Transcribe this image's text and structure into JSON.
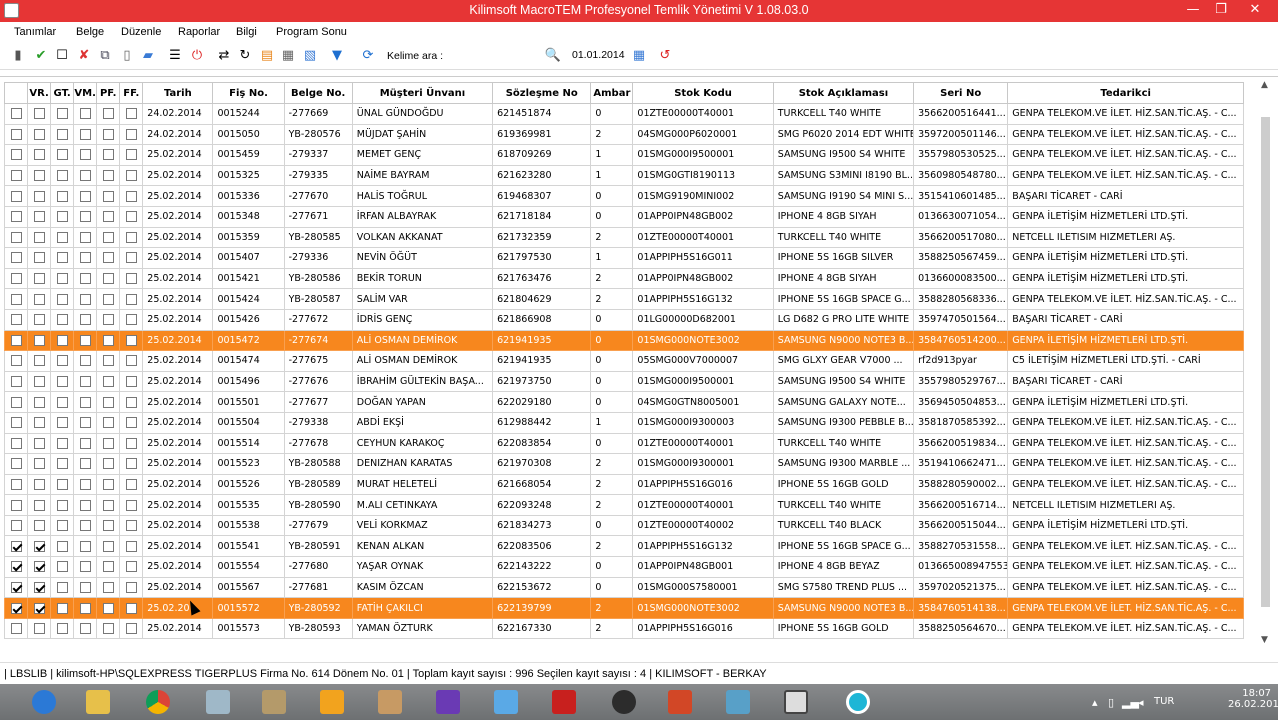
{
  "window": {
    "title": "Kilimsoft MacroTEM Profesyonel Temlik Yönetimi V 1.08.03.0"
  },
  "menu": [
    "Tanımlar",
    "Belge",
    "Düzenle",
    "Raporlar",
    "Bilgi",
    "Program Sonu"
  ],
  "toolbar": {
    "search_label": "Kelime ara :",
    "search_value": "",
    "date": "01.01.2014"
  },
  "grid": {
    "columns": [
      "",
      "VR.",
      "GT.",
      "VM.",
      "PF.",
      "FF.",
      "Tarih",
      "Fiş No.",
      "Belge No.",
      "Müşteri Ünvanı",
      "Sözleşme No",
      "Ambar",
      "Stok Kodu",
      "Stok Açıklaması",
      "Seri No",
      "Tedarikci"
    ],
    "rows": [
      {
        "checks": [
          false,
          false,
          false,
          false,
          false,
          false
        ],
        "cells": [
          "24.02.2014",
          "0015244",
          "-277669",
          "ÜNAL GÜNDOĞDU",
          "621451874",
          "0",
          "01ZTE00000T40001",
          "TURKCELL T40 WHITE",
          "3566200516441...",
          "GENPA TELEKOM.VE İLET. HİZ.SAN.TİC.AŞ. - C..."
        ],
        "selected": false
      },
      {
        "checks": [
          false,
          false,
          false,
          false,
          false,
          false
        ],
        "cells": [
          "24.02.2014",
          "0015050",
          "YB-280576",
          "MÜJDAT ŞAHİN",
          "619369981",
          "2",
          "04SMG000P6020001",
          "SMG P6020 2014 EDT WHITE",
          "3597200501146...",
          "GENPA TELEKOM.VE İLET. HİZ.SAN.TİC.AŞ. - C..."
        ],
        "selected": false
      },
      {
        "checks": [
          false,
          false,
          false,
          false,
          false,
          false
        ],
        "cells": [
          "25.02.2014",
          "0015459",
          "-279337",
          "MEMET GENÇ",
          "618709269",
          "1",
          "01SMG000I9500001",
          "SAMSUNG I9500 S4 WHITE",
          "3557980530525...",
          "GENPA TELEKOM.VE İLET. HİZ.SAN.TİC.AŞ. - C..."
        ],
        "selected": false
      },
      {
        "checks": [
          false,
          false,
          false,
          false,
          false,
          false
        ],
        "cells": [
          "25.02.2014",
          "0015325",
          "-279335",
          "NAİME BAYRAM",
          "621623280",
          "1",
          "01SMG0GTI8190113",
          "SAMSUNG S3MINI I8190 BL...",
          "3560980548780...",
          "GENPA TELEKOM.VE İLET. HİZ.SAN.TİC.AŞ. - C..."
        ],
        "selected": false
      },
      {
        "checks": [
          false,
          false,
          false,
          false,
          false,
          false
        ],
        "cells": [
          "25.02.2014",
          "0015336",
          "-277670",
          "HALİS TOĞRUL",
          "619468307",
          "0",
          "01SMG9190MINI002",
          "SAMSUNG I9190 S4 MINI S...",
          "3515410601485...",
          "BAŞARI TİCARET - CARİ"
        ],
        "selected": false
      },
      {
        "checks": [
          false,
          false,
          false,
          false,
          false,
          false
        ],
        "cells": [
          "25.02.2014",
          "0015348",
          "-277671",
          "İRFAN ALBAYRAK",
          "621718184",
          "0",
          "01APP0IPN48GB002",
          "IPHONE 4 8GB SIYAH",
          "0136630071054...",
          "GENPA İLETİŞİM HİZMETLERİ LTD.ŞTİ."
        ],
        "selected": false
      },
      {
        "checks": [
          false,
          false,
          false,
          false,
          false,
          false
        ],
        "cells": [
          "25.02.2014",
          "0015359",
          "YB-280585",
          "VOLKAN AKKANAT",
          "621732359",
          "2",
          "01ZTE00000T40001",
          "TURKCELL T40 WHITE",
          "3566200517080...",
          "NETCELL ILETISIM HIZMETLERI AŞ."
        ],
        "selected": false
      },
      {
        "checks": [
          false,
          false,
          false,
          false,
          false,
          false
        ],
        "cells": [
          "25.02.2014",
          "0015407",
          "-279336",
          "NEVİN ÖĞÜT",
          "621797530",
          "1",
          "01APPIPH5S16G011",
          "IPHONE 5S 16GB SILVER",
          "3588250567459...",
          "GENPA İLETİŞİM HİZMETLERİ LTD.ŞTİ."
        ],
        "selected": false
      },
      {
        "checks": [
          false,
          false,
          false,
          false,
          false,
          false
        ],
        "cells": [
          "25.02.2014",
          "0015421",
          "YB-280586",
          "BEKİR TORUN",
          "621763476",
          "2",
          "01APP0IPN48GB002",
          "IPHONE 4 8GB SIYAH",
          "0136600083500...",
          "GENPA İLETİŞİM HİZMETLERİ LTD.ŞTİ."
        ],
        "selected": false
      },
      {
        "checks": [
          false,
          false,
          false,
          false,
          false,
          false
        ],
        "cells": [
          "25.02.2014",
          "0015424",
          "YB-280587",
          "SALİM VAR",
          "621804629",
          "2",
          "01APPIPH5S16G132",
          "IPHONE 5S 16GB SPACE G...",
          "3588280568336...",
          "GENPA TELEKOM.VE İLET. HİZ.SAN.TİC.AŞ. - C..."
        ],
        "selected": false
      },
      {
        "checks": [
          false,
          false,
          false,
          false,
          false,
          false
        ],
        "cells": [
          "25.02.2014",
          "0015426",
          "-277672",
          "İDRİS GENÇ",
          "621866908",
          "0",
          "01LG00000D682001",
          "LG D682 G PRO LITE WHITE",
          "3597470501564...",
          "BAŞARI TİCARET - CARİ"
        ],
        "selected": false
      },
      {
        "checks": [
          false,
          false,
          false,
          false,
          false,
          false
        ],
        "cells": [
          "25.02.2014",
          "0015472",
          "-277674",
          "ALİ OSMAN DEMİROK",
          "621941935",
          "0",
          "01SMG000NOTE3002",
          "SAMSUNG N9000 NOTE3 B...",
          "3584760514200...",
          "GENPA İLETİŞİM HİZMETLERİ LTD.ŞTİ."
        ],
        "selected": true
      },
      {
        "checks": [
          false,
          false,
          false,
          false,
          false,
          false
        ],
        "cells": [
          "25.02.2014",
          "0015474",
          "-277675",
          "ALİ OSMAN DEMİROK",
          "621941935",
          "0",
          "05SMG000V7000007",
          "SMG GLXY GEAR V7000 ...",
          "rf2d913pyar",
          "C5 İLETİŞİM HİZMETLERİ LTD.ŞTİ. - CARİ"
        ],
        "selected": false
      },
      {
        "checks": [
          false,
          false,
          false,
          false,
          false,
          false
        ],
        "cells": [
          "25.02.2014",
          "0015496",
          "-277676",
          "İBRAHİM GÜLTEKİN BAŞA...",
          "621973750",
          "0",
          "01SMG000I9500001",
          "SAMSUNG I9500 S4 WHITE",
          "3557980529767...",
          "BAŞARI TİCARET - CARİ"
        ],
        "selected": false
      },
      {
        "checks": [
          false,
          false,
          false,
          false,
          false,
          false
        ],
        "cells": [
          "25.02.2014",
          "0015501",
          "-277677",
          "DOĞAN YAPAN",
          "622029180",
          "0",
          "04SMG0GTN8005001",
          "SAMSUNG GALAXY NOTE...",
          "3569450504853...",
          "GENPA İLETİŞİM HİZMETLERİ LTD.ŞTİ."
        ],
        "selected": false
      },
      {
        "checks": [
          false,
          false,
          false,
          false,
          false,
          false
        ],
        "cells": [
          "25.02.2014",
          "0015504",
          "-279338",
          "ABDİ EKŞİ",
          "612988442",
          "1",
          "01SMG000I9300003",
          "SAMSUNG I9300 PEBBLE B...",
          "3581870585392...",
          "GENPA TELEKOM.VE İLET. HİZ.SAN.TİC.AŞ. - C..."
        ],
        "selected": false
      },
      {
        "checks": [
          false,
          false,
          false,
          false,
          false,
          false
        ],
        "cells": [
          "25.02.2014",
          "0015514",
          "-277678",
          "CEYHUN KARAKOÇ",
          "622083854",
          "0",
          "01ZTE00000T40001",
          "TURKCELL T40 WHITE",
          "3566200519834...",
          "GENPA TELEKOM.VE İLET. HİZ.SAN.TİC.AŞ. - C..."
        ],
        "selected": false
      },
      {
        "checks": [
          false,
          false,
          false,
          false,
          false,
          false
        ],
        "cells": [
          "25.02.2014",
          "0015523",
          "YB-280588",
          "DENIZHAN KARATAS",
          "621970308",
          "2",
          "01SMG000I9300001",
          "SAMSUNG I9300 MARBLE ...",
          "3519410662471...",
          "GENPA TELEKOM.VE İLET. HİZ.SAN.TİC.AŞ. - C..."
        ],
        "selected": false
      },
      {
        "checks": [
          false,
          false,
          false,
          false,
          false,
          false
        ],
        "cells": [
          "25.02.2014",
          "0015526",
          "YB-280589",
          "MURAT HELETELİ",
          "621668054",
          "2",
          "01APPIPH5S16G016",
          "IPHONE 5S 16GB GOLD",
          "3588280590002...",
          "GENPA TELEKOM.VE İLET. HİZ.SAN.TİC.AŞ. - C..."
        ],
        "selected": false
      },
      {
        "checks": [
          false,
          false,
          false,
          false,
          false,
          false
        ],
        "cells": [
          "25.02.2014",
          "0015535",
          "YB-280590",
          "M.ALI CETINKAYA",
          "622093248",
          "2",
          "01ZTE00000T40001",
          "TURKCELL T40 WHITE",
          "3566200516714...",
          "NETCELL ILETISIM HIZMETLERI AŞ."
        ],
        "selected": false
      },
      {
        "checks": [
          false,
          false,
          false,
          false,
          false,
          false
        ],
        "cells": [
          "25.02.2014",
          "0015538",
          "-277679",
          "VELİ KORKMAZ",
          "621834273",
          "0",
          "01ZTE00000T40002",
          "TURKCELL T40 BLACK",
          "3566200515044...",
          "GENPA İLETİŞİM HİZMETLERİ LTD.ŞTİ."
        ],
        "selected": false
      },
      {
        "checks": [
          true,
          true,
          false,
          false,
          false,
          false
        ],
        "cells": [
          "25.02.2014",
          "0015541",
          "YB-280591",
          "KENAN ALKAN",
          "622083506",
          "2",
          "01APPIPH5S16G132",
          "IPHONE 5S 16GB SPACE G...",
          "3588270531558...",
          "GENPA TELEKOM.VE İLET. HİZ.SAN.TİC.AŞ. - C..."
        ],
        "selected": false
      },
      {
        "checks": [
          true,
          true,
          false,
          false,
          false,
          false
        ],
        "cells": [
          "25.02.2014",
          "0015554",
          "-277680",
          "YAŞAR OYNAK",
          "622143222",
          "0",
          "01APP0IPN48GB001",
          "IPHONE 4 8GB BEYAZ",
          "013665008947553",
          "GENPA TELEKOM.VE İLET. HİZ.SAN.TİC.AŞ. - C..."
        ],
        "selected": false
      },
      {
        "checks": [
          true,
          true,
          false,
          false,
          false,
          false
        ],
        "cells": [
          "25.02.2014",
          "0015567",
          "-277681",
          "KASIM ÖZCAN",
          "622153672",
          "0",
          "01SMG000S7580001",
          "SMG S7580 TREND PLUS ...",
          "3597020521375...",
          "GENPA TELEKOM.VE İLET. HİZ.SAN.TİC.AŞ. - C..."
        ],
        "selected": false
      },
      {
        "checks": [
          true,
          true,
          false,
          false,
          false,
          false
        ],
        "cells": [
          "25.02.20",
          "0015572",
          "YB-280592",
          "FATİH ÇAKILCI",
          "622139799",
          "2",
          "01SMG000NOTE3002",
          "SAMSUNG N9000 NOTE3 B...",
          "3584760514138...",
          "GENPA TELEKOM.VE İLET. HİZ.SAN.TİC.AŞ. - C..."
        ],
        "selected": true
      },
      {
        "checks": [
          false,
          false,
          false,
          false,
          false,
          false
        ],
        "cells": [
          "25.02.2014",
          "0015573",
          "YB-280593",
          "YAMAN ÖZTURK",
          "622167330",
          "2",
          "01APPIPH5S16G016",
          "IPHONE 5S 16GB GOLD",
          "3588250564670...",
          "GENPA TELEKOM.VE İLET. HİZ.SAN.TİC.AŞ. - C..."
        ],
        "selected": false
      }
    ]
  },
  "status": {
    "text": "|  LBSLIB  |  kilimsoft-HP\\SQLEXPRESS TIGERPLUS Firma No. 614 Dönem No. 01  |  Toplam kayıt sayısı : 996 Seçilen kayıt sayısı : 4  |  KILIMSOFT - BERKAY"
  },
  "taskbar": {
    "lang": "TUR",
    "time": "18:07",
    "date": "26.02.2014"
  },
  "colors": {
    "titlebar": "#e63535",
    "selected_row": "#f7871e"
  }
}
